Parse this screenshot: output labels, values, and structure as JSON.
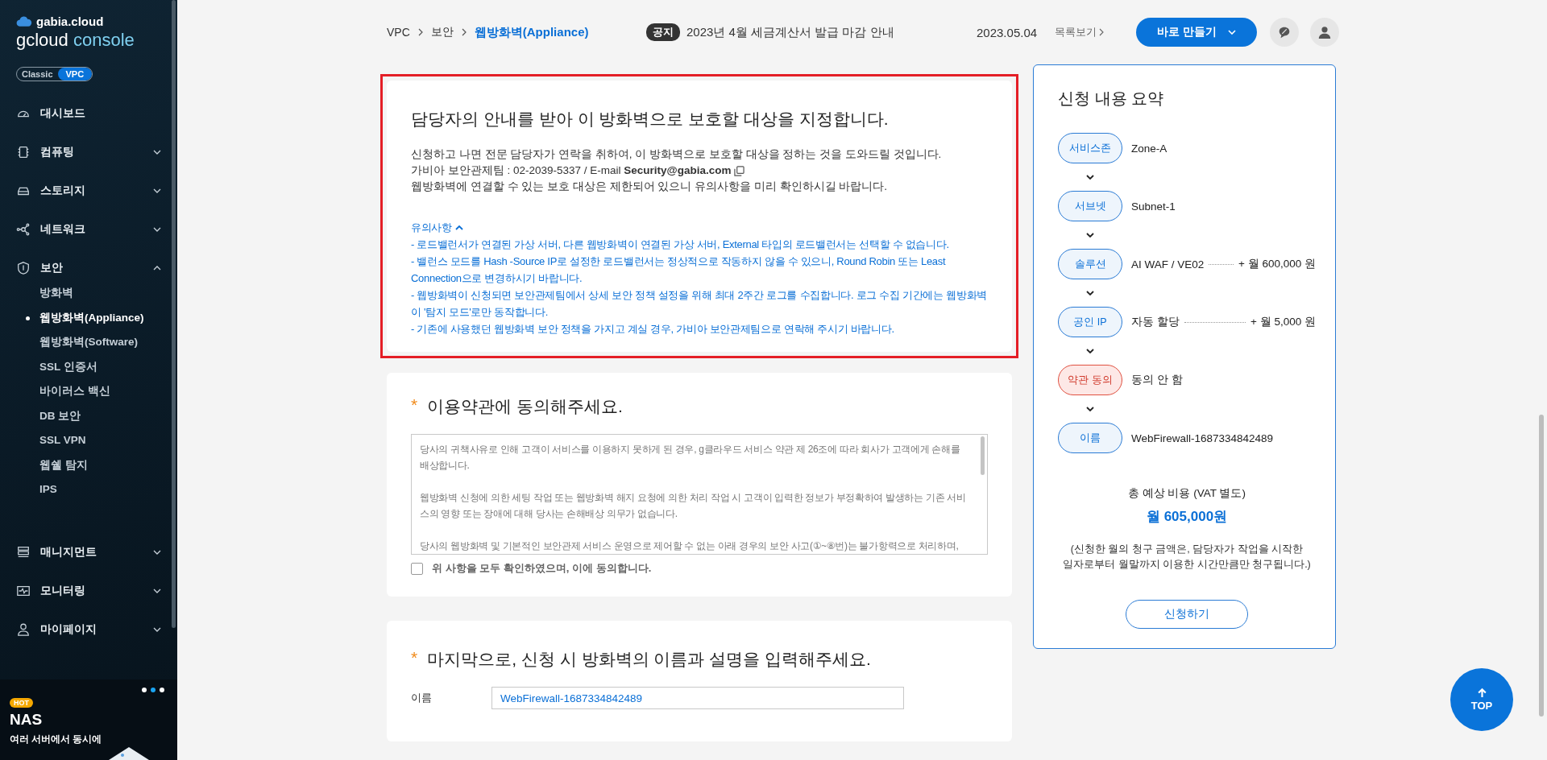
{
  "sidebar": {
    "brand": "gabia.cloud",
    "title_main": "gcloud",
    "title_accent": "console",
    "modes": [
      {
        "label": "Classic",
        "selected": false
      },
      {
        "label": "VPC",
        "selected": true
      }
    ],
    "menu": [
      {
        "kind": "link",
        "label": "대시보드"
      },
      {
        "kind": "group",
        "label": "컴퓨팅",
        "expanded": false
      },
      {
        "kind": "group",
        "label": "스토리지",
        "expanded": false
      },
      {
        "kind": "group",
        "label": "네트워크",
        "expanded": false
      },
      {
        "kind": "group",
        "label": "보안",
        "expanded": true,
        "children": [
          {
            "label": "방화벽",
            "selected": false
          },
          {
            "label": "웹방화벽(Appliance)",
            "selected": true
          },
          {
            "label": "웹방화벽(Software)",
            "selected": false
          },
          {
            "label": "SSL 인증서",
            "selected": false
          },
          {
            "label": "바이러스 백신",
            "selected": false
          },
          {
            "label": "DB 보안",
            "selected": false
          },
          {
            "label": "SSL VPN",
            "selected": false
          },
          {
            "label": "웹쉘 탐지",
            "selected": false
          },
          {
            "label": "IPS",
            "selected": false
          }
        ]
      },
      {
        "kind": "group",
        "label": "매니지먼트",
        "expanded": false
      },
      {
        "kind": "group",
        "label": "모니터링",
        "expanded": false
      },
      {
        "kind": "group",
        "label": "마이페이지",
        "expanded": false
      }
    ],
    "promo": {
      "badge": "HOT",
      "title": "NAS",
      "text": "여러 서버에서 동시에",
      "pages": [
        {
          "selected": false
        },
        {
          "selected": true
        },
        {
          "selected": false
        }
      ]
    }
  },
  "header": {
    "breadcrumb": [
      "VPC",
      "보안",
      "웹방화벽(Appliance)"
    ],
    "notice": {
      "badge": "공지",
      "text": "2023년 4월 세금계산서 발급 마감 안내",
      "date": "2023.05.04",
      "more": "목록보기"
    },
    "create_button": "바로 만들기"
  },
  "info": {
    "title": "담당자의 안내를 받아 이 방화벽으로 보호할 대상을 지정합니다.",
    "lines": [
      "신청하고 나면 전문 담당자가 연락을 취하여, 이 방화벽으로 보호할 대상을 정하는 것을 도와드릴 것입니다.",
      "가비아 보안관제팀 : 02-2039-5337 / E-mail **Security@gabia.com**",
      "웹방화벽에 연결할 수 있는 보호 대상은 제한되어 있으니 유의사항을 미리 확인하시길 바랍니다."
    ],
    "notes": {
      "title": "유의사항",
      "expanded": true,
      "items": [
        "- 로드밸런서가 연결된 가상 서버, 다른 웹방화벽이 연결된 가상 서버, External 타입의 로드밸런서는 선택할 수 없습니다.",
        "- 밸런스 모드를 Hash -Source IP로 설정한 로드밸런서는 정상적으로 작동하지 않을 수 있으니, Round Robin 또는 Least Connection으로 변경하시기 바랍니다.",
        "- 웹방화벽이 신청되면 보안관제팀에서 상세 보안 정책 설정을 위해 최대 2주간 로그를 수집합니다. 로그 수집 기간에는 웹방화벽이 '탐지 모드'로만 동작합니다.",
        "- 기존에 사용했던 웹방화벽 보안 정책을 가지고 계실 경우, 가비아 보안관제팀으로 연락해 주시기 바랍니다."
      ]
    }
  },
  "terms": {
    "required_mark": "*",
    "title": "이용약관에 동의해주세요.",
    "paragraphs": [
      "당사의 귀책사유로 인해 고객이 서비스를 이용하지 못하게 된 경우, g클라우드 서비스 약관 제 26조에 따라 회사가 고객에게 손해를 배상합니다.",
      "웹방화벽 신청에 의한 세팅 작업 또는 웹방화벽 해지 요청에 의한 처리 작업 시 고객이 입력한 정보가 부정확하여 발생하는 기존 서비스의 영향 또는 장애에 대해 당사는 손해배상 의무가 없습니다.",
      "당사의 웹방화벽 및 기본적인 보안관제 서비스 운영으로 제어할 수 없는 아래 경우의 보안 사고(①~⑧번)는 불가항력으로 처리하며,"
    ],
    "agree": {
      "label": "위 사항을 모두 확인하였으며, 이에 동의합니다.",
      "checked": false
    }
  },
  "name_form": {
    "required_mark": "*",
    "title": "마지막으로, 신청 시 방화벽의 이름과 설명을 입력해주세요.",
    "field_label": "이름",
    "value": "WebFirewall-1687334842489"
  },
  "summary": {
    "title": "신청 내용 요약",
    "steps": [
      {
        "label": "서비스존",
        "value": "Zone-A",
        "error": false
      },
      {
        "label": "서브넷",
        "value": "Subnet-1",
        "error": false
      },
      {
        "label": "솔루션",
        "value": "AI WAF / VE02",
        "price": "+ 월 600,000 원",
        "error": false
      },
      {
        "label": "공인 IP",
        "value": "자동 할당",
        "price": "+ 월 5,000 원",
        "error": false
      },
      {
        "label": "약관 동의",
        "value": "동의 안 함",
        "error": true
      },
      {
        "label": "이름",
        "value": "WebFirewall-1687334842489",
        "error": false
      }
    ],
    "total_label": "총 예상 비용 (VAT 별도)",
    "total": "월 605,000원",
    "note_lines": [
      "(신청한 월의 청구 금액은, 담당자가 작업을 시작한",
      "일자로부터 월말까지 이용한 시간만큼만 청구됩니다.)"
    ],
    "submit": "신청하기"
  },
  "top_button": "TOP"
}
